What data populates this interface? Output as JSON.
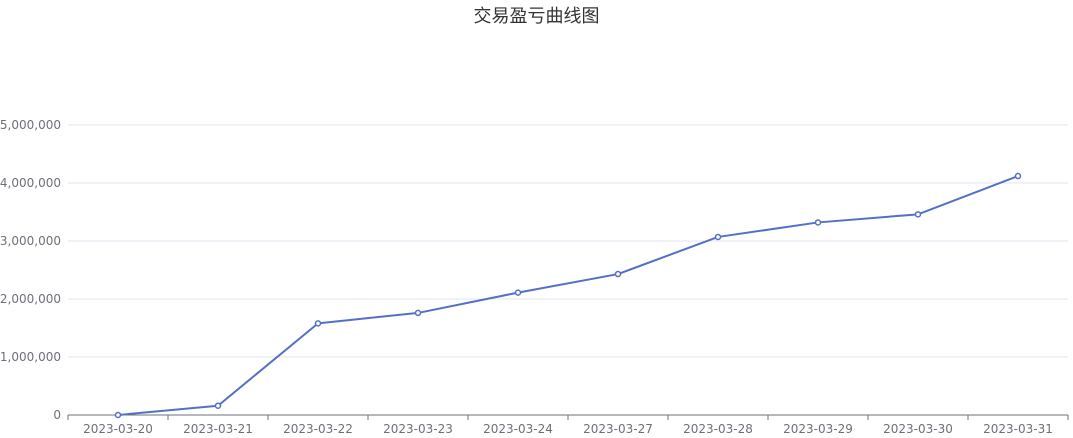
{
  "chart_data": {
    "type": "line",
    "title": "交易盈亏曲线图",
    "xlabel": "",
    "ylabel": "",
    "categories": [
      "2023-03-20",
      "2023-03-21",
      "2023-03-22",
      "2023-03-23",
      "2023-03-24",
      "2023-03-27",
      "2023-03-28",
      "2023-03-29",
      "2023-03-30",
      "2023-03-31"
    ],
    "series": [
      {
        "values": [
          0,
          160000,
          1580000,
          1760000,
          2110000,
          2430000,
          3070000,
          3320000,
          3460000,
          4120000
        ]
      }
    ],
    "ylim": [
      0,
      5000000
    ],
    "yticks": [
      0,
      1000000,
      2000000,
      3000000,
      4000000,
      5000000
    ],
    "ytick_labels": [
      "0",
      "1,000,000",
      "2,000,000",
      "3,000,000",
      "4,000,000",
      "5,000,000"
    ],
    "grid": true,
    "line_color": "#5470c6",
    "grid_color": "#e0e6f1",
    "axis_color": "#6e7079"
  }
}
